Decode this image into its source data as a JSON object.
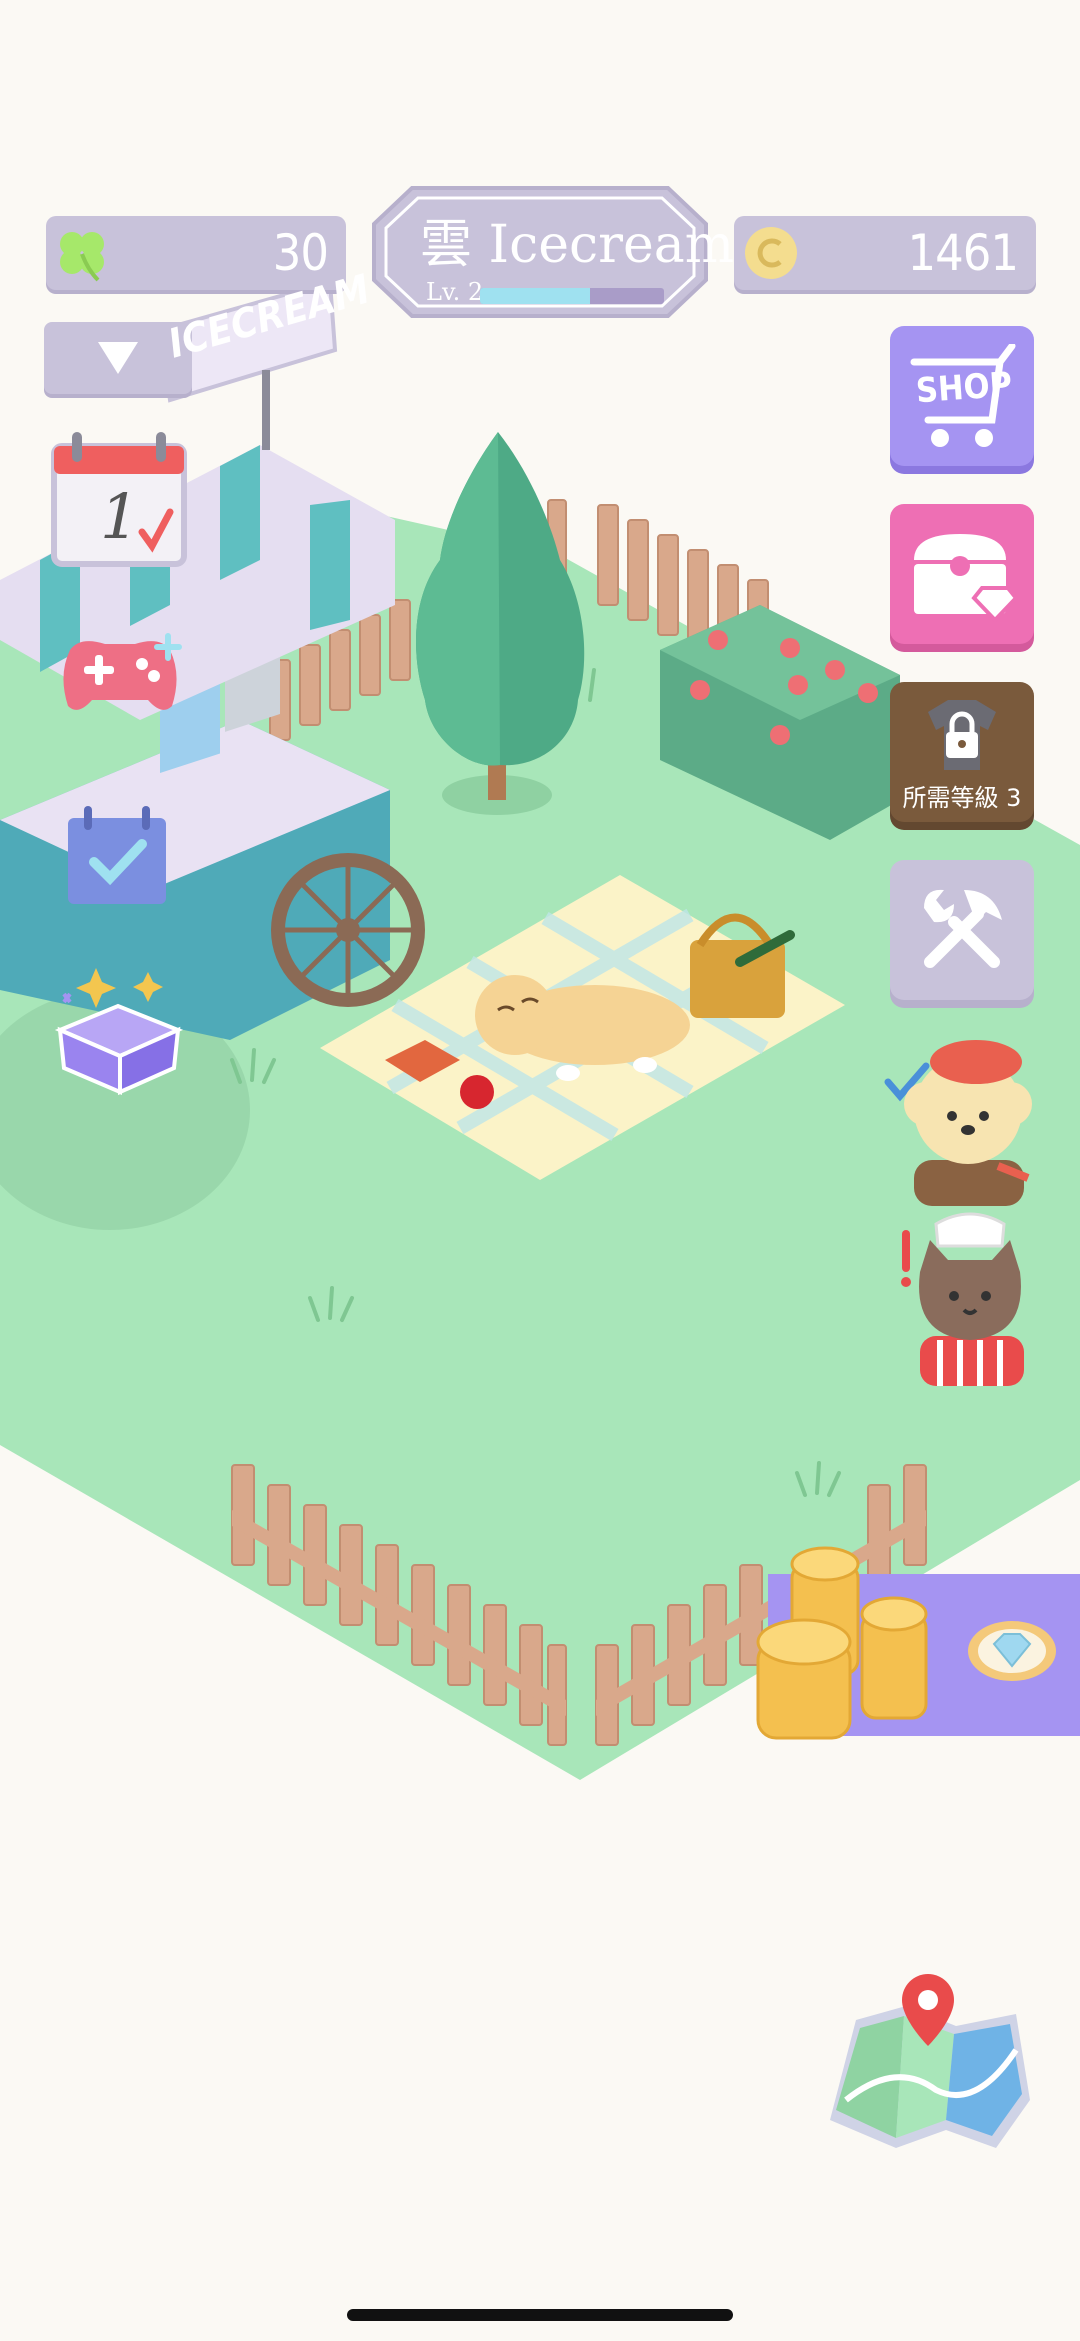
{
  "hud": {
    "clover_count": "30",
    "coin_count": "1461",
    "title": "雲 Icecream",
    "level_label": "Lv. 2",
    "level_progress": 0.6,
    "cart_sign": "ICECREAM"
  },
  "side_buttons": {
    "shop_label": "SHOP",
    "locked_label": "所需等級 3"
  },
  "left_menu": {
    "calendar_day": "1"
  },
  "colors": {
    "accent_purple": "#a594f2",
    "gift_pink": "#ee6fb4",
    "locked_brown": "#7a5a3c",
    "tools_lilac": "#c8c2da",
    "grass": "#a8e6b9"
  },
  "icons": [
    "clover-icon",
    "coin-icon",
    "dropdown-icon",
    "calendar-icon",
    "gamepad-icon",
    "task-icon",
    "gift-box-icon",
    "shop-cart-icon",
    "treasure-chest-icon",
    "locked-shirt-icon",
    "tools-icon",
    "poodle-avatar-icon",
    "cat-chef-avatar-icon",
    "coins-offer-icon",
    "diamond-icon",
    "map-icon"
  ]
}
